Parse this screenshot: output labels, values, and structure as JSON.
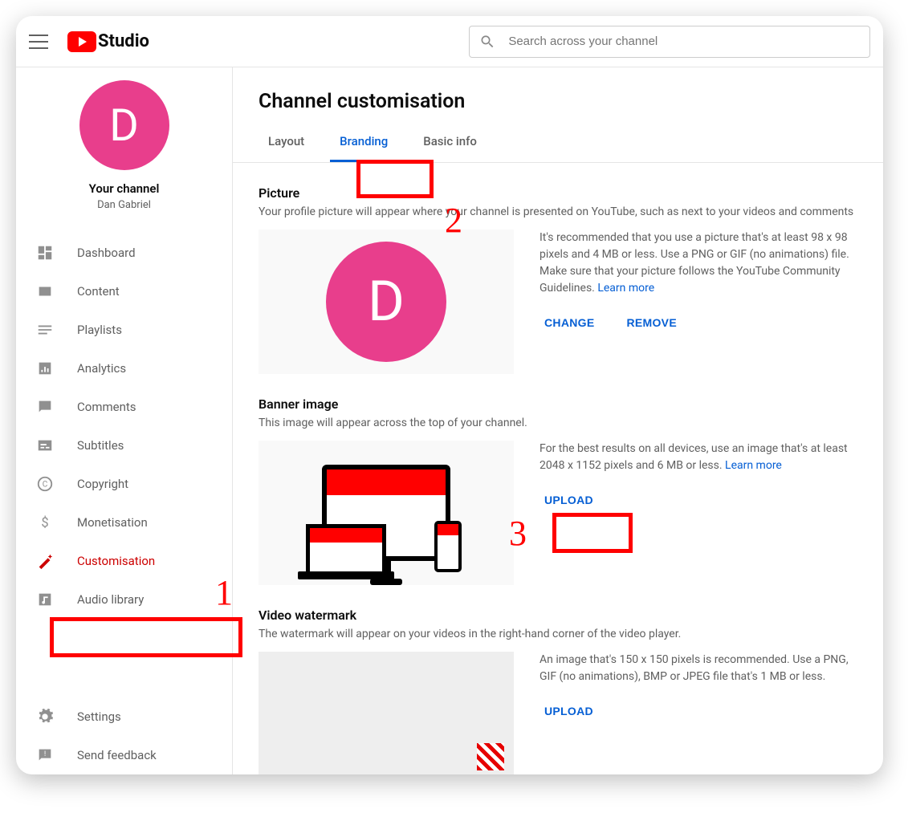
{
  "header": {
    "logo_text": "Studio",
    "search_placeholder": "Search across your channel"
  },
  "sidebar": {
    "avatar_letter": "D",
    "your_channel": "Your channel",
    "channel_name": "Dan Gabriel",
    "items": [
      {
        "label": "Dashboard"
      },
      {
        "label": "Content"
      },
      {
        "label": "Playlists"
      },
      {
        "label": "Analytics"
      },
      {
        "label": "Comments"
      },
      {
        "label": "Subtitles"
      },
      {
        "label": "Copyright"
      },
      {
        "label": "Monetisation"
      },
      {
        "label": "Customisation"
      },
      {
        "label": "Audio library"
      }
    ],
    "footer": [
      {
        "label": "Settings"
      },
      {
        "label": "Send feedback"
      }
    ]
  },
  "page": {
    "title": "Channel customisation",
    "tabs": [
      {
        "label": "Layout"
      },
      {
        "label": "Branding"
      },
      {
        "label": "Basic info"
      }
    ]
  },
  "picture": {
    "heading": "Picture",
    "desc": "Your profile picture will appear where your channel is presented on YouTube, such as next to your videos and comments",
    "info": "It's recommended that you use a picture that's at least 98 x 98 pixels and 4 MB or less. Use a PNG or GIF (no animations) file. Make sure that your picture follows the YouTube Community Guidelines. ",
    "learn_more": "Learn more",
    "change": "CHANGE",
    "remove": "REMOVE",
    "avatar_letter": "D"
  },
  "banner": {
    "heading": "Banner image",
    "desc": "This image will appear across the top of your channel.",
    "info": "For the best results on all devices, use an image that's at least 2048 x 1152 pixels and 6 MB or less. ",
    "learn_more": "Learn more",
    "upload": "UPLOAD"
  },
  "watermark": {
    "heading": "Video watermark",
    "desc": "The watermark will appear on your videos in the right-hand corner of the video player.",
    "info": "An image that's 150 x 150 pixels is recommended. Use a PNG, GIF (no animations), BMP or JPEG file that's 1 MB or less.",
    "upload": "UPLOAD"
  },
  "annotations": {
    "n1": "1",
    "n2": "2",
    "n3": "3"
  }
}
